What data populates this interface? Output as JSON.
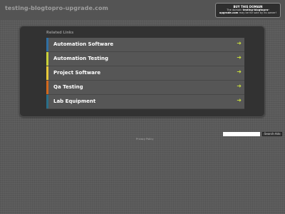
{
  "header": {
    "domain": "testing-blogtopro-upgrade.com"
  },
  "buy_domain": {
    "title": "BUY THIS DOMAIN",
    "text_prefix": "The domain ",
    "domain": "testing-blogtopro-upgrade.com",
    "text_suffix": " may be for sale by its owner!"
  },
  "related": {
    "title": "Related Links",
    "links": [
      {
        "label": "Automation Software",
        "accent": "#2f6fa3"
      },
      {
        "label": "Automation Testing",
        "accent": "#c9d13a"
      },
      {
        "label": "Project Software",
        "accent": "#e8c93a"
      },
      {
        "label": "Qa Testing",
        "accent": "#d2691e"
      },
      {
        "label": "Lab Equipment",
        "accent": "#2a6f8a"
      }
    ],
    "arrow_icon": "arrow-right-icon",
    "arrow_color": "#c7dc3c"
  },
  "search": {
    "placeholder": "",
    "button_label": "Search Ads"
  },
  "footer": {
    "privacy_label": "Privacy Policy"
  }
}
